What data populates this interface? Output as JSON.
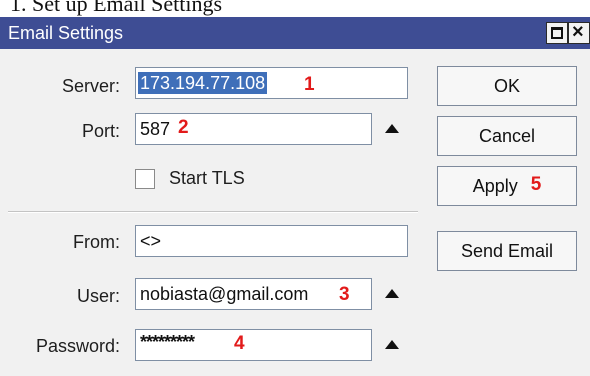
{
  "header_fragment": "1. Set up Email Settings",
  "window": {
    "title": "Email Settings",
    "maximize_icon": "window-maximize-icon",
    "close_icon": "close-icon"
  },
  "form": {
    "server": {
      "label": "Server:",
      "value": "173.194.77.108",
      "annotation": "1"
    },
    "port": {
      "label": "Port:",
      "value": "587",
      "annotation": "2"
    },
    "start_tls": {
      "label": "Start TLS",
      "checked": false
    },
    "from": {
      "label": "From:",
      "value": "<>"
    },
    "user": {
      "label": "User:",
      "value": "nobiasta@gmail.com",
      "annotation": "3"
    },
    "password": {
      "label": "Password:",
      "value": "*********",
      "annotation": "4"
    }
  },
  "buttons": {
    "ok": "OK",
    "cancel": "Cancel",
    "apply": "Apply",
    "apply_annotation": "5",
    "send_email": "Send Email"
  },
  "colors": {
    "titlebar": "#3e4d94",
    "annotation": "#e21a1a",
    "selection": "#3f6fb9"
  }
}
